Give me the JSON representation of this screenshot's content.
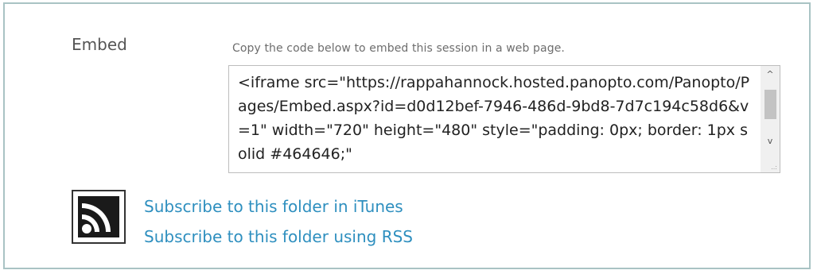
{
  "embed": {
    "label": "Embed",
    "hint": "Copy the code below to embed this session in a web page.",
    "code": "<iframe src=\"https://rappahannock.hosted.panopto.com/Panopto/Pages/Embed.aspx?id=d0d12bef-7946-486d-9bd8-7d7c194c58d6&v=1\" width=\"720\" height=\"480\" style=\"padding: 0px; border: 1px solid #464646;\"",
    "scroll_up_glyph": "^",
    "scroll_down_glyph": "v",
    "grip_glyph": "..:"
  },
  "subscribe": {
    "icon": "rss-icon",
    "itunes_label": "Subscribe to this folder in iTunes",
    "rss_label": "Subscribe to this folder using RSS"
  },
  "colors": {
    "frame_border": "#a9c3c4",
    "link": "#2e8fbf",
    "label_text": "#555555"
  }
}
